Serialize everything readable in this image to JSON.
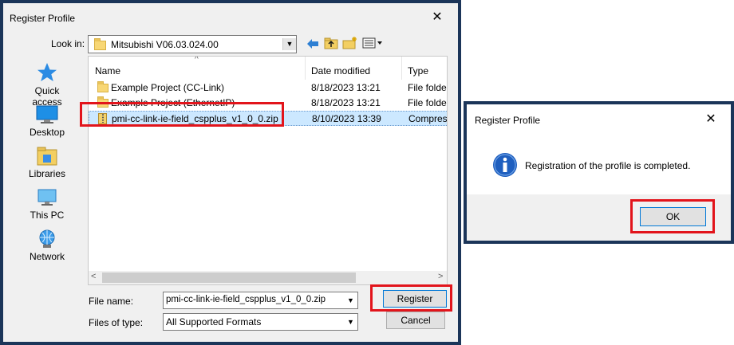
{
  "register_dialog": {
    "title": "Register Profile",
    "look_in_label": "Look in:",
    "look_in_value": "Mitsubishi V06.03.024.00",
    "toolbar_icons": [
      "back-arrow-icon",
      "up-folder-icon",
      "new-folder-icon",
      "view-menu-icon"
    ],
    "places": [
      {
        "label": "Quick access",
        "icon": "quick-access-star-icon"
      },
      {
        "label": "Desktop",
        "icon": "desktop-icon"
      },
      {
        "label": "Libraries",
        "icon": "libraries-icon"
      },
      {
        "label": "This PC",
        "icon": "this-pc-icon"
      },
      {
        "label": "Network",
        "icon": "network-icon"
      }
    ],
    "columns": {
      "name": "Name",
      "date_modified": "Date modified",
      "type": "Type"
    },
    "files": [
      {
        "name": "Example Project (CC-Link)",
        "date": "8/18/2023 13:21",
        "type": "File folder",
        "kind": "folder"
      },
      {
        "name": "Example Project (EthernetIP)",
        "date": "8/18/2023 13:21",
        "type": "File folder",
        "kind": "folder"
      },
      {
        "name": "pmi-cc-link-ie-field_cspplus_v1_0_0.zip",
        "date": "8/10/2023 13:39",
        "type": "Compress",
        "kind": "zip"
      }
    ],
    "file_name_label": "File name:",
    "file_name_value": "pmi-cc-link-ie-field_cspplus_v1_0_0.zip",
    "files_of_type_label": "Files of type:",
    "files_of_type_value": "All Supported Formats",
    "register_button": "Register",
    "cancel_button": "Cancel"
  },
  "message_dialog": {
    "title": "Register Profile",
    "message": "Registration of the profile is completed.",
    "ok_button": "OK"
  },
  "colors": {
    "frame": "#1b3559",
    "highlight": "#e2141b",
    "selected_row": "#cce8ff",
    "info_icon": "#1f5fbf"
  }
}
